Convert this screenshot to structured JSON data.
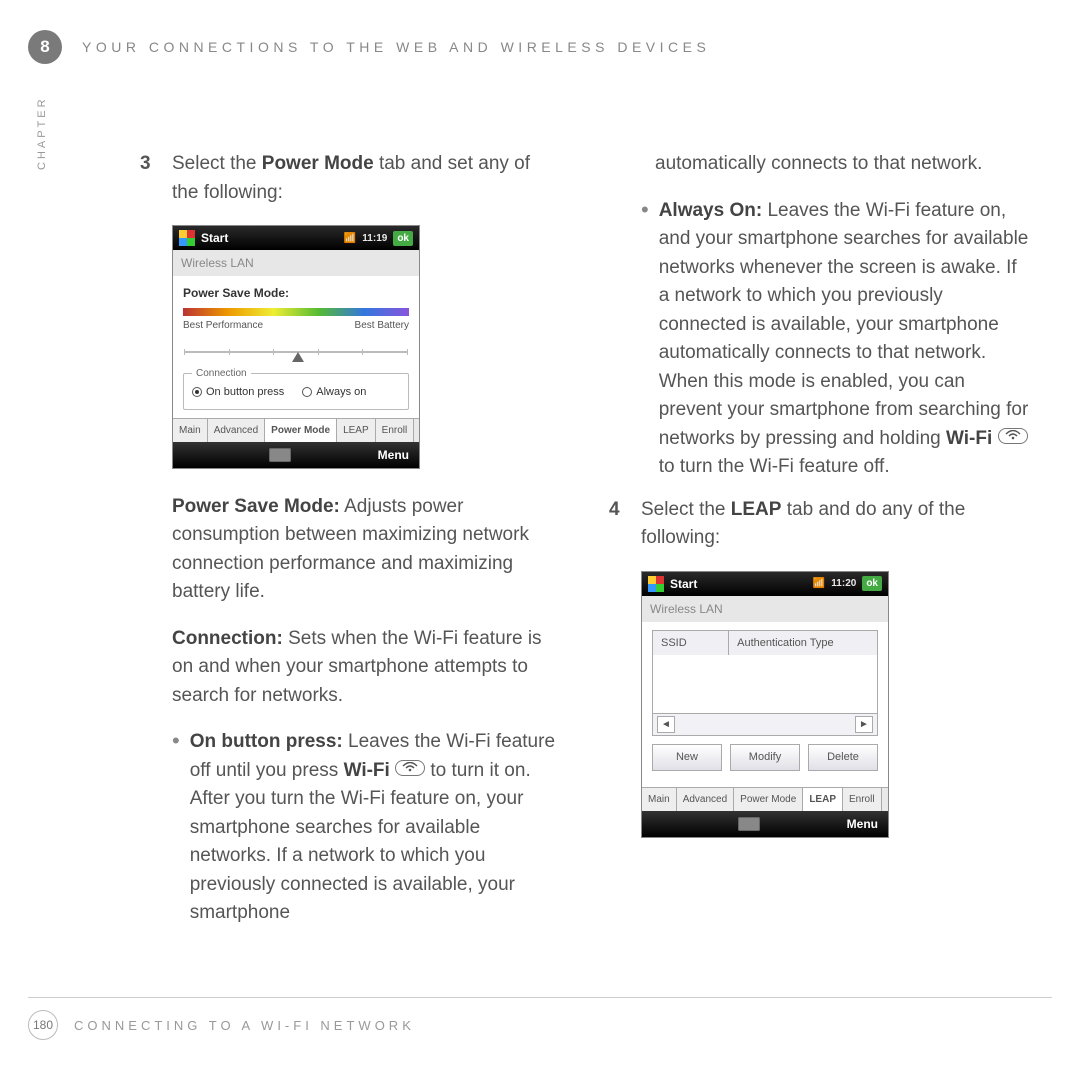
{
  "header": {
    "chapter_number": "8",
    "chapter_label": "CHAPTER",
    "title": "YOUR CONNECTIONS TO THE WEB AND WIRELESS DEVICES"
  },
  "footer": {
    "page": "180",
    "title": "CONNECTING TO A WI-FI NETWORK"
  },
  "step3": {
    "num": "3",
    "intro_a": "Select the ",
    "intro_bold": "Power Mode",
    "intro_b": " tab and set any of the following:"
  },
  "psm": {
    "label": "Power Save Mode:",
    "text": " Adjusts power consumption between maximizing network connection performance and maximizing battery life."
  },
  "conn": {
    "label": "Connection:",
    "text": " Sets when the Wi-Fi feature is on and when your smartphone attempts to search for networks."
  },
  "onbtn": {
    "label": "On button press:",
    "text_a": " Leaves the Wi-Fi feature off until you press ",
    "wifi": "Wi-Fi",
    "text_b": " to turn it on. After you turn the Wi-Fi feature on, your smartphone searches for available networks. If a network to which you previously connected is available, your smartphone"
  },
  "col2_cont": "automatically connects to that network.",
  "always": {
    "label": "Always On:",
    "text_a": " Leaves the Wi-Fi feature on, and your smartphone searches for available networks whenever the screen is awake. If a network to which you previously connected is available, your smartphone automatically connects to that network. When this mode is enabled, you can prevent your smartphone from searching for networks by pressing and holding ",
    "wifi": "Wi-Fi",
    "text_b": " to turn the Wi-Fi feature off."
  },
  "step4": {
    "num": "4",
    "intro_a": "Select the ",
    "intro_bold": "LEAP",
    "intro_b": " tab and do any of the following:"
  },
  "shot1": {
    "start": "Start",
    "time": "11:19",
    "ok": "ok",
    "title": "Wireless LAN",
    "heading": "Power Save Mode:",
    "left": "Best Performance",
    "right": "Best Battery",
    "legend": "Connection",
    "r1": "On button press",
    "r2": "Always on",
    "tabs": [
      "Main",
      "Advanced",
      "Power Mode",
      "LEAP",
      "Enroll"
    ],
    "active_tab": 2,
    "menu": "Menu"
  },
  "shot2": {
    "start": "Start",
    "time": "11:20",
    "ok": "ok",
    "title": "Wireless LAN",
    "col1": "SSID",
    "col2": "Authentication Type",
    "btns": [
      "New",
      "Modify",
      "Delete"
    ],
    "tabs": [
      "Main",
      "Advanced",
      "Power Mode",
      "LEAP",
      "Enroll"
    ],
    "active_tab": 3,
    "menu": "Menu"
  }
}
